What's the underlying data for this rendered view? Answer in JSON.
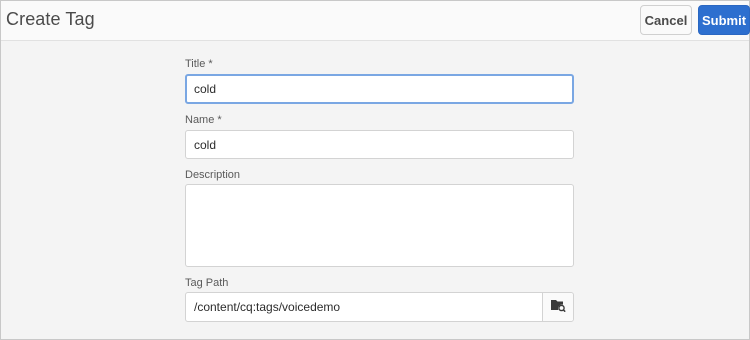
{
  "header": {
    "title": "Create Tag",
    "cancel_label": "Cancel",
    "submit_label": "Submit"
  },
  "form": {
    "title_label": "Title *",
    "title_value": "cold",
    "name_label": "Name *",
    "name_value": "cold",
    "description_label": "Description",
    "description_value": "",
    "tag_path_label": "Tag Path",
    "tag_path_value": "/content/cq:tags/voicedemo",
    "picker_icon": "folder-search-icon"
  },
  "colors": {
    "accent": "#2d6fcf",
    "focus_border": "#7aa7e3",
    "background": "#f4f4f4"
  }
}
